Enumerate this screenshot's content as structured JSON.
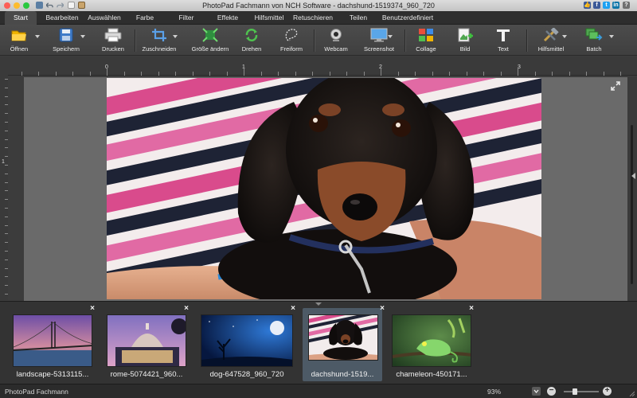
{
  "window": {
    "title": "PhotoPad Fachmann von NCH Software - dachshund-1519374_960_720"
  },
  "menu_tabs": [
    "Start",
    "Bearbeiten",
    "Auswählen",
    "Farbe",
    "Filter",
    "Effekte",
    "Hilfsmittel",
    "Retuschieren",
    "Teilen",
    "Benutzerdefiniert"
  ],
  "active_tab": "Start",
  "toolbar": {
    "open": "Öffnen",
    "save": "Speichern",
    "print": "Drucken",
    "crop": "Zuschneiden",
    "resize": "Größe ändern",
    "rotate": "Drehen",
    "freeform": "Freiform",
    "webcam": "Webcam",
    "screenshot": "Screenshot",
    "collage": "Collage",
    "image": "Bild",
    "text": "Text",
    "tools": "Hilfsmittel",
    "batch": "Batch"
  },
  "ruler": {
    "h_marks": [
      "0",
      "1",
      "2",
      "3"
    ],
    "v_marks": [
      "1"
    ]
  },
  "social_icons": [
    "thumbs-up-icon",
    "facebook-icon",
    "twitter-icon",
    "linkedin-icon",
    "help-icon"
  ],
  "thumbnails": [
    {
      "name": "landscape-5313115...",
      "subject": "bridge at dusk",
      "selected": false
    },
    {
      "name": "rome-5074421_960...",
      "subject": "st peters basilica",
      "selected": false
    },
    {
      "name": "dog-647528_960_720",
      "subject": "dog under moon",
      "selected": false
    },
    {
      "name": "dachshund-1519...",
      "subject": "dachshund puppy",
      "selected": true
    },
    {
      "name": "chameleon-450171...",
      "subject": "chameleon on branch",
      "selected": false
    }
  ],
  "status": {
    "text": "PhotoPad Fachmann",
    "zoom": "93%",
    "zoom_fraction": 0.3
  },
  "colors": {
    "accent": "#4d5a66",
    "toolbar_bg": "#444444",
    "canvas_bg": "#6a6a6a"
  }
}
